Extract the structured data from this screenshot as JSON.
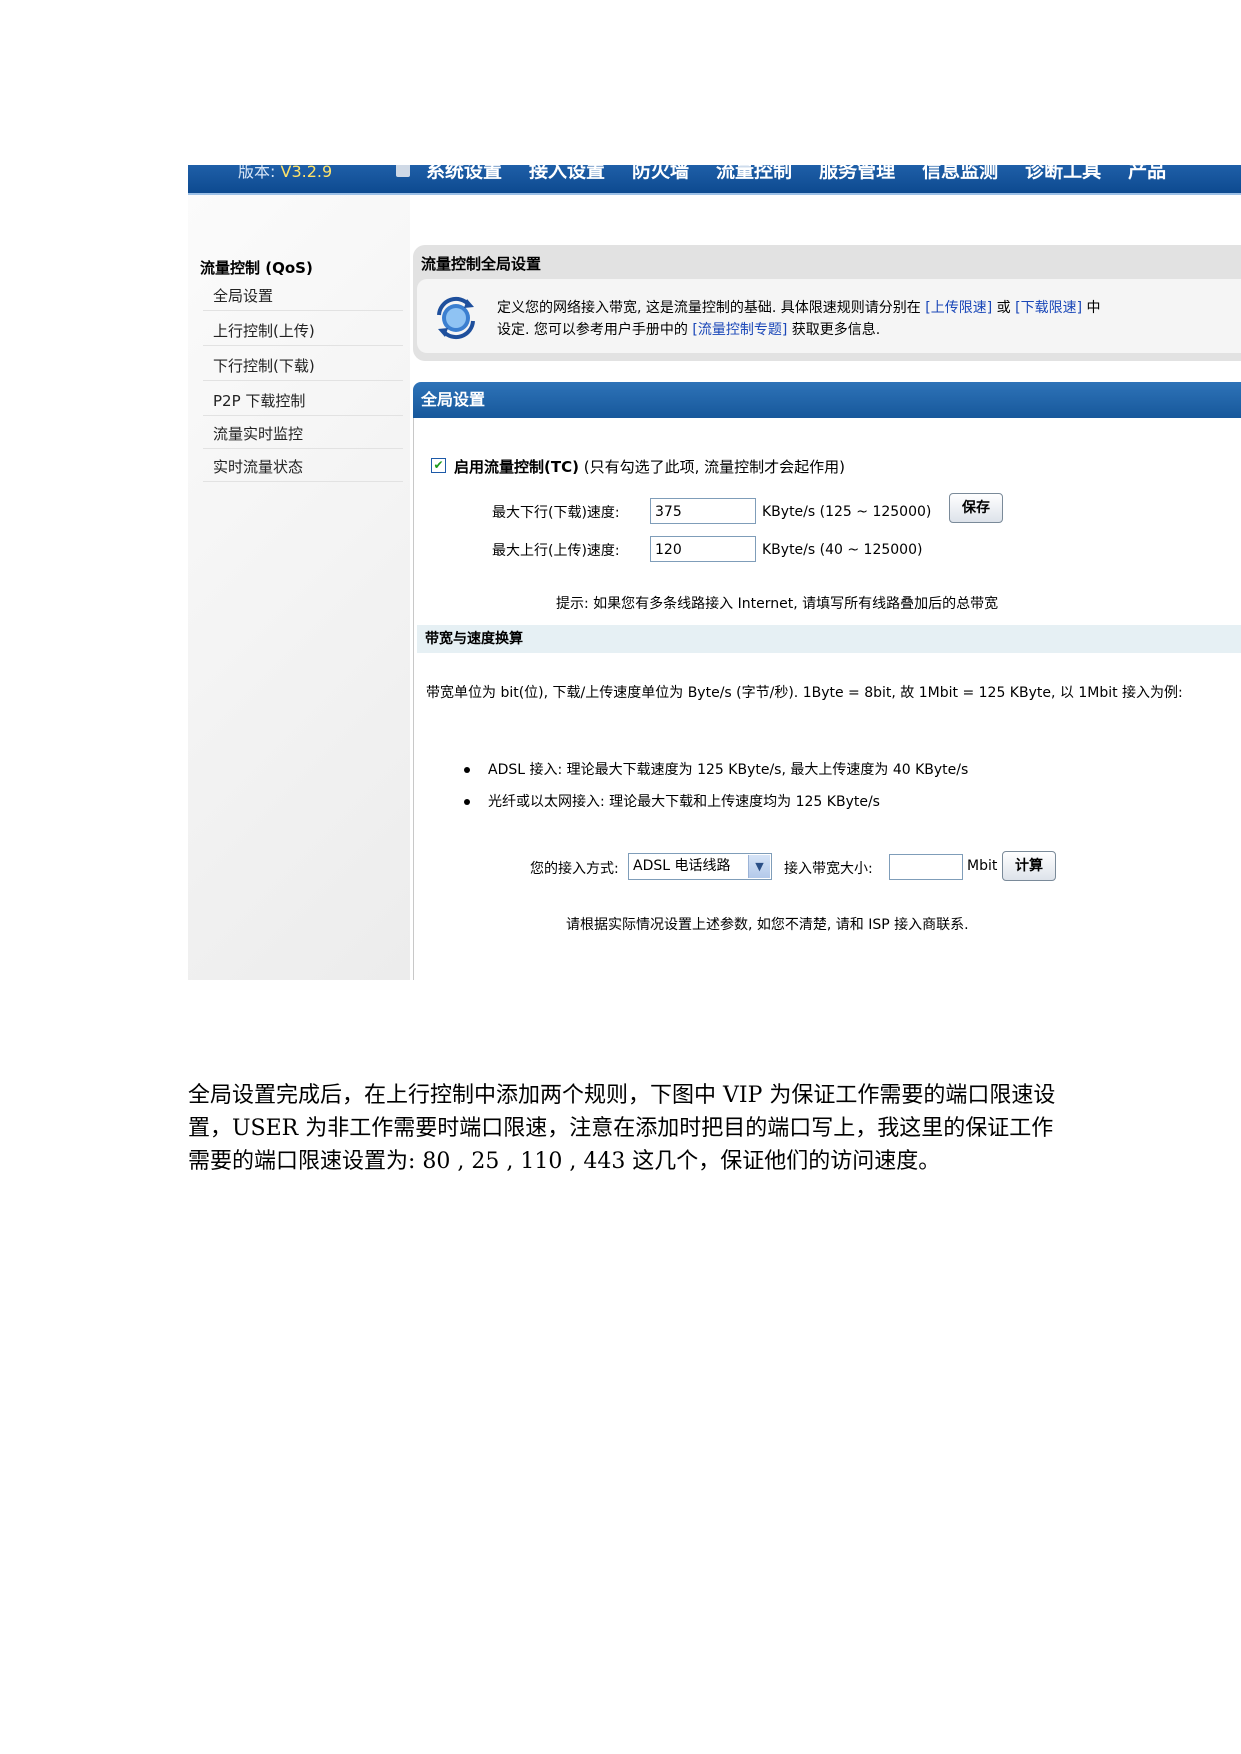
{
  "topbar": {
    "version_label": "版本:",
    "version_number": "V3.2.9",
    "menu": [
      "系统设置",
      "接入设置",
      "防火墙",
      "流量控制",
      "服务管理",
      "信息监测",
      "诊断工具",
      "产品"
    ]
  },
  "sidebar": {
    "title": "流量控制 (QoS)",
    "items": [
      "全局设置",
      "上行控制(上传)",
      "下行控制(下载)",
      "P2P 下载控制",
      "流量实时监控",
      "实时流量状态"
    ]
  },
  "info": {
    "heading": "流量控制全局设置",
    "line1_a": "定义您的网络接入带宽, 这是流量控制的基础. 具体限速规则请分别在",
    "link_upload": "[上传限速]",
    "line1_or": "或",
    "link_download": "[下载限速]",
    "line1_b": "中",
    "line2_a": "设定. 您可以参考用户手册中的",
    "link_manual": "[流量控制专题]",
    "line2_b": "获取更多信息."
  },
  "panel": {
    "title": "全局设置",
    "enable_bold": "启用流量控制(TC)",
    "enable_note": "(只有勾选了此项, 流量控制才会起作用)",
    "enable_checked": true,
    "down_label": "最大下行(下载)速度:",
    "down_value": "375",
    "down_unit": "KByte/s   (125 ~ 125000)",
    "save_button": "保存",
    "up_label": "最大上行(上传)速度:",
    "up_value": "120",
    "up_unit": "KByte/s   (40 ~ 125000)",
    "hint": "提示: 如果您有多条线路接入  Internet, 请填写所有线路叠加后的总带宽",
    "convert_title": "带宽与速度换算",
    "convert_text": "带宽单位为  bit(位), 下载/上传速度单位为  Byte/s (字节/秒). 1Byte = 8bit, 故  1Mbit = 125 KByte, 以  1Mbit 接入为例:",
    "bullet1": "ADSL 接入: 理论最大下载速度为  125 KByte/s, 最大上传速度为  40 KByte/s",
    "bullet2": "光纤或以太网接入: 理论最大下载和上传速度均为  125 KByte/s",
    "access_label": "您的接入方式:",
    "access_selected": "ADSL 电话线路",
    "bandwidth_label": "接入带宽大小:",
    "bandwidth_value": "",
    "bandwidth_unit": "Mbit",
    "calc_button": "计算",
    "contact": "请根据实际情况设置上述参数, 如您不清楚, 请和  ISP 接入商联系."
  },
  "paragraph": "全局设置完成后，在上行控制中添加两个规则，下图中 VIP 为保证工作需要的端口限速设置，USER 为非工作需要时端口限速，注意在添加时把目的端口写上，我这里的保证工作需要的端口限速设置为:  80 ,  25 ,  110 ,  443 这几个，保证他们的访问速度。"
}
